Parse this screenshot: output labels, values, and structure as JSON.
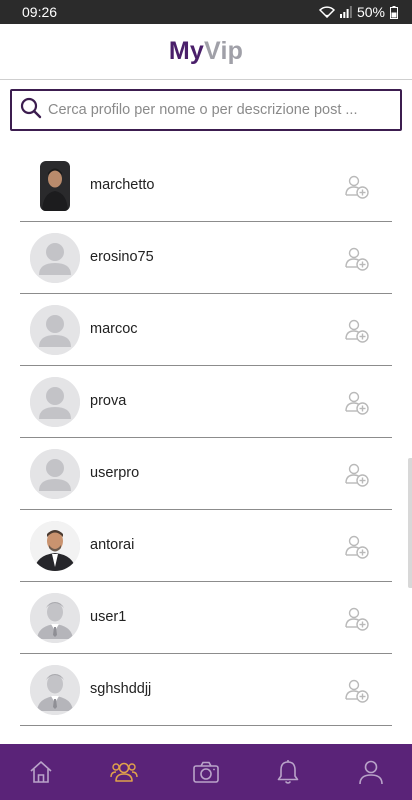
{
  "status_bar": {
    "time": "09:26",
    "battery": "50%"
  },
  "header": {
    "title_part1": "My",
    "title_part2": "Vip"
  },
  "search": {
    "placeholder": "Cerca profilo per nome o per descrizione post ..."
  },
  "users": [
    {
      "name": "marchetto",
      "avatar": "photo-dark"
    },
    {
      "name": "erosino75",
      "avatar": "default"
    },
    {
      "name": "marcoc",
      "avatar": "default"
    },
    {
      "name": "prova",
      "avatar": "default"
    },
    {
      "name": "userpro",
      "avatar": "default"
    },
    {
      "name": "antorai",
      "avatar": "photo-suit"
    },
    {
      "name": "user1",
      "avatar": "business"
    },
    {
      "name": "sghshddjj",
      "avatar": "business"
    }
  ],
  "bottom_nav": [
    {
      "icon": "home-icon",
      "active": false
    },
    {
      "icon": "users-icon",
      "active": true
    },
    {
      "icon": "camera-icon",
      "active": false
    },
    {
      "icon": "bell-icon",
      "active": false
    },
    {
      "icon": "profile-icon",
      "active": false
    }
  ],
  "colors": {
    "brand": "#4a1f6a",
    "nav_bg": "#5a2378",
    "active_nav": "#e0a24a"
  }
}
